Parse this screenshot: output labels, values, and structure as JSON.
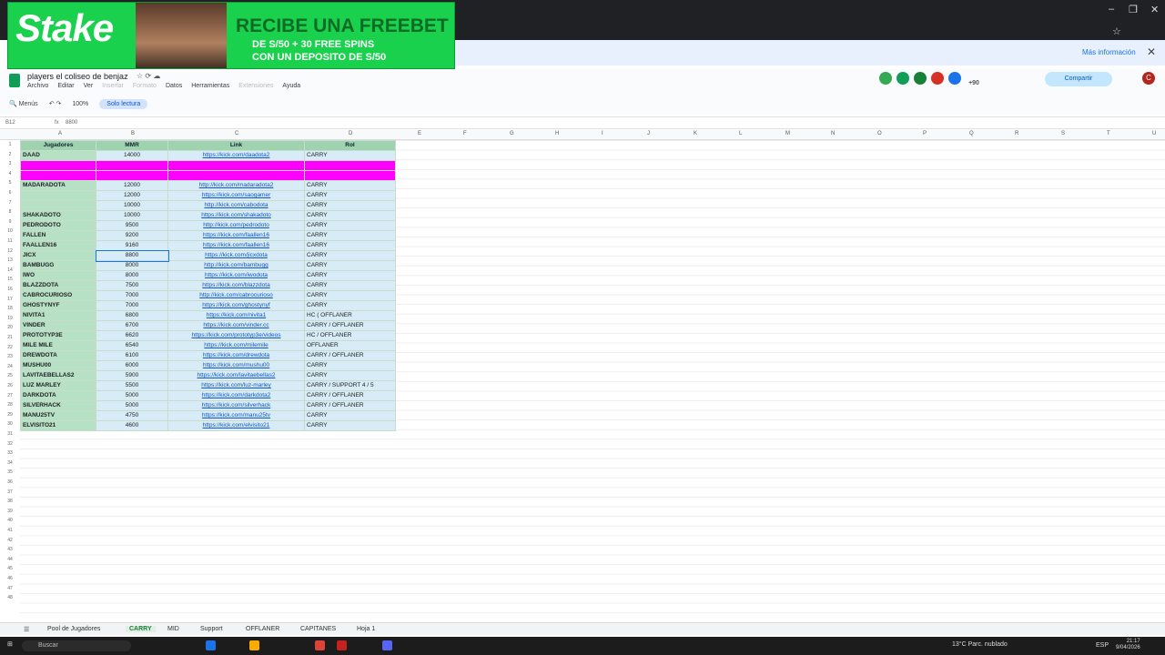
{
  "window": {
    "minimize": "–",
    "maximize": "❐",
    "close": "✕"
  },
  "ad": {
    "logo": "Stake",
    "headline": "RECIBE UNA FREEBET",
    "line2": "DE S/50 + 30 FREE SPINS",
    "line3": "CON UN DEPOSITO DE S/50",
    "more_info": "Más información",
    "close": "✕"
  },
  "doc": {
    "title": "players el coliseo de benjaz",
    "menus": [
      "Archivo",
      "Editar",
      "Ver",
      "Insertar",
      "Formato",
      "Datos",
      "Herramientas",
      "Extensiones",
      "Ayuda"
    ],
    "disabled_menus": [
      "Insertar",
      "Formato",
      "Extensiones"
    ],
    "share_label": "Compartir",
    "avatar_letter": "C",
    "collab_count": "+90"
  },
  "toolbar": {
    "menus_label": "Menús",
    "zoom": "100%",
    "readonly_label": "Solo lectura"
  },
  "formula_bar": {
    "cell_ref": "B12",
    "fx": "fx",
    "value": "8800"
  },
  "columns": [
    "A",
    "B",
    "C",
    "D",
    "E",
    "F",
    "G",
    "H",
    "I",
    "J",
    "K",
    "L",
    "M",
    "N",
    "O",
    "P",
    "Q",
    "R",
    "S",
    "T",
    "U"
  ],
  "header_row": {
    "a": "Jugadores",
    "b": "MMR",
    "c": "Link",
    "d": "Rol"
  },
  "rows": [
    {
      "a": "DAAD",
      "b": "14000",
      "c": "https://kick.com/daadota2",
      "d": "CARRY"
    },
    {
      "a": "",
      "b": "",
      "c": "",
      "d": "",
      "pink": true
    },
    {
      "a": "",
      "b": "",
      "c": "",
      "d": "",
      "pink": true
    },
    {
      "a": "MADARADOTA",
      "b": "12000",
      "c": "http://kick.com/madaradota2",
      "d": "CARRY"
    },
    {
      "a": "",
      "b": "12000",
      "c": "https://kick.com/saogamer",
      "d": "CARRY"
    },
    {
      "a": "",
      "b": "10000",
      "c": "http://kick.com/cabodota",
      "d": "CARRY"
    },
    {
      "a": "SHAKADOTO",
      "b": "10000",
      "c": "https://kick.com/shakadoto",
      "d": "CARRY",
      "big": true
    },
    {
      "a": "PEDRODOTO",
      "b": "9500",
      "c": "http://kick.com/pedrodoto",
      "d": "CARRY"
    },
    {
      "a": "FALLEN",
      "b": "9200",
      "c": "https://kick.com/faallen16",
      "d": "CARRY",
      "big": true
    },
    {
      "a": "FAALLEN16",
      "b": "9160",
      "c": "https://kick.com/faallen16",
      "d": "CARRY",
      "big": true
    },
    {
      "a": "JICX",
      "b": "8800",
      "c": "https://kick.com/jicxdota",
      "d": "CARRY"
    },
    {
      "a": "BAMBUGG",
      "b": "8000",
      "c": "http://kick.com/bambugg",
      "d": "CARRY"
    },
    {
      "a": "IWO",
      "b": "8000",
      "c": "https://kick.com/iwodota",
      "d": "CARRY"
    },
    {
      "a": "BLAZZDOTA",
      "b": "7500",
      "c": "https://kick.com/blazzdota",
      "d": "CARRY",
      "big": true
    },
    {
      "a": "CABROCURIOSO",
      "b": "7000",
      "c": "http://kick.com/cabrocurioso",
      "d": "CARRY"
    },
    {
      "a": "GHOSTYNYF",
      "b": "7000",
      "c": "https://kick.com/ghostynyf",
      "d": "CARRY"
    },
    {
      "a": "NIVITA1",
      "b": "6800",
      "c": "https://kick.com/nivita1",
      "d": "HC ( OFFLANER"
    },
    {
      "a": "VINDER",
      "b": "6700",
      "c": "https://kick.com/vinder.cc",
      "d": "CARRY / OFFLANER"
    },
    {
      "a": "PROTOTYP3E",
      "b": "6620",
      "c": "https://kick.com/prototyp3e/videos",
      "d": "HC / OFFLANER"
    },
    {
      "a": "MILE MILE",
      "b": "6540",
      "c": "https://kick.com/milemile",
      "d": "OFFLANER"
    },
    {
      "a": "DREWDOTA",
      "b": "6100",
      "c": "https://kick.com/drewdota",
      "d": "CARRY / OFFLANER"
    },
    {
      "a": "MUSHU00",
      "b": "6000",
      "c": "https://kick.com/mushu00",
      "d": "CARRY",
      "big": true
    },
    {
      "a": "LAVITAEBELLAS2",
      "b": "5900",
      "c": "https://kick.com/lavitaebellas2",
      "d": "CARRY",
      "big": true
    },
    {
      "a": "LUZ MARLEY",
      "b": "5500",
      "c": "https://kick.com/luz-marley",
      "d": "CARRY / SUPPORT 4 / 5"
    },
    {
      "a": "DARKDOTA",
      "b": "5000",
      "c": "https://kick.com/darkdota2",
      "d": "CARRY / OFFLANER",
      "big": true
    },
    {
      "a": "SILVERHACK",
      "b": "5000",
      "c": "https://kick.com/silverhack",
      "d": "CARRY / OFFLANER",
      "big": true
    },
    {
      "a": "MANU25TV",
      "b": "4750",
      "c": "https://kick.com/manu25tv",
      "d": "CARRY",
      "big": true
    },
    {
      "a": "ELVISITO21",
      "b": "4600",
      "c": "https://kick.com/elvisito21",
      "d": "CARRY",
      "big": true
    }
  ],
  "tabs": [
    "Pool de Jugadores",
    "CARRY",
    "MID",
    "Support",
    "OFFLANER",
    "CAPITANES",
    "Hoja 1"
  ],
  "active_tab": "CARRY",
  "taskbar": {
    "search": "Buscar",
    "weather": "13°C Parc. nublado",
    "lang": "ESP",
    "time": "21:17",
    "date": "9/04/2026"
  }
}
